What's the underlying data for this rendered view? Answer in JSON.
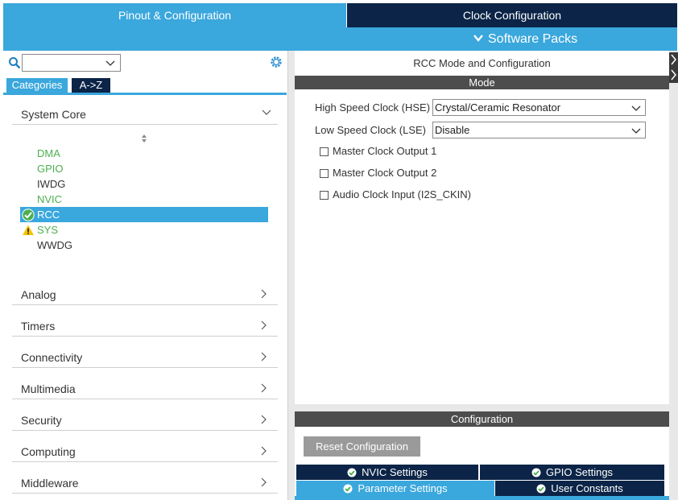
{
  "top_tabs": {
    "pinout": "Pinout & Configuration",
    "clock": "Clock Configuration"
  },
  "software_packs": "Software Packs",
  "left": {
    "tabs": {
      "categories": "Categories",
      "az": "A->Z"
    },
    "search_value": "",
    "system_core": {
      "label": "System Core",
      "items": [
        "DMA",
        "GPIO",
        "IWDG",
        "NVIC",
        "RCC",
        "SYS",
        "WWDG"
      ]
    },
    "categories": [
      "Analog",
      "Timers",
      "Connectivity",
      "Multimedia",
      "Security",
      "Computing",
      "Middleware"
    ]
  },
  "right": {
    "title": "RCC Mode and Configuration",
    "mode_header": "Mode",
    "hse_label": "High Speed Clock (HSE)",
    "hse_value": "Crystal/Ceramic Resonator",
    "lse_label": "Low Speed Clock (LSE)",
    "lse_value": "Disable",
    "checkboxes": [
      "Master Clock Output 1",
      "Master Clock Output 2",
      "Audio Clock Input (I2S_CKIN)"
    ]
  },
  "config": {
    "header": "Configuration",
    "reset_button": "Reset Configuration",
    "tabs": {
      "nvic": "NVIC Settings",
      "gpio": "GPIO Settings",
      "param": "Parameter Settings",
      "user": "User Constants"
    }
  },
  "colors": {
    "accent": "#3aa7dd",
    "navy": "#0b2447",
    "header_gray": "#4d4d4d",
    "ok_green": "#4caf50",
    "warn_yellow": "#f5c400"
  }
}
